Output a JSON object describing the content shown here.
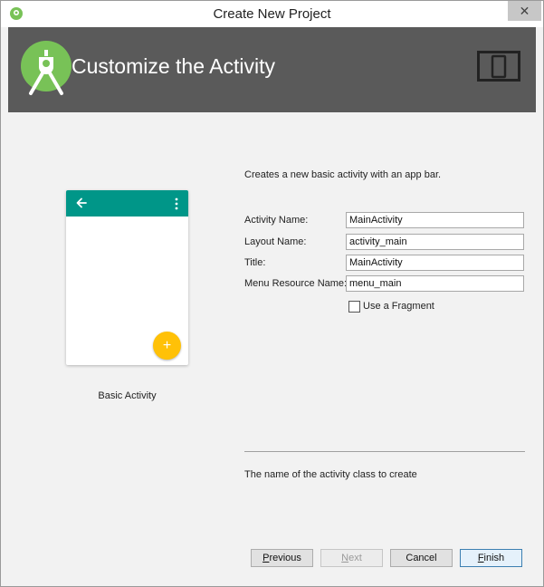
{
  "window": {
    "title": "Create New Project",
    "close_symbol": "✕"
  },
  "header": {
    "heading": "Customize the Activity",
    "logo_icon": "android-studio-logo-icon",
    "device_icon": "phone-tablet-icon"
  },
  "template": {
    "name": "Basic Activity",
    "fab_symbol": "+",
    "appbar_color": "#009688",
    "fab_color": "#ffc107"
  },
  "form": {
    "description": "Creates a new basic activity with an app bar.",
    "fields": [
      {
        "label": "Activity Name:",
        "value": "MainActivity"
      },
      {
        "label": "Layout Name:",
        "value": "activity_main"
      },
      {
        "label": "Title:",
        "value": "MainActivity"
      },
      {
        "label": "Menu Resource Name:",
        "value": "menu_main"
      }
    ],
    "fragment_checkbox": {
      "label": "Use a Fragment",
      "checked": false
    }
  },
  "help": {
    "text": "The name of the activity class to create"
  },
  "buttons": {
    "previous": {
      "mnemonic": "P",
      "rest": "revious"
    },
    "next": {
      "mnemonic": "N",
      "rest": "ext",
      "enabled": false
    },
    "cancel": {
      "label": "Cancel"
    },
    "finish": {
      "mnemonic": "F",
      "rest": "inish"
    }
  },
  "colors": {
    "header_bg": "#5a5a5a",
    "android_green": "#78c257",
    "primary_border": "#3c7fb1"
  }
}
